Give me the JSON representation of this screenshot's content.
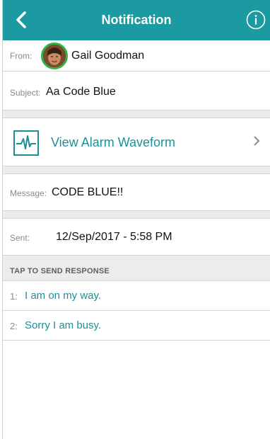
{
  "nav": {
    "title": "Notification"
  },
  "from": {
    "label": "From:",
    "name": "Gail Goodman"
  },
  "subject": {
    "label": "Subject:",
    "value": "Aa Code Blue"
  },
  "waveform": {
    "label": "View Alarm Waveform"
  },
  "message": {
    "label": "Message:",
    "value": "CODE BLUE!!"
  },
  "sent": {
    "label": "Sent:",
    "value": "12/Sep/2017 - 5:58 PM"
  },
  "responses": {
    "header": "TAP TO SEND RESPONSE",
    "items": [
      {
        "index": "1:",
        "text": "I am on my way."
      },
      {
        "index": "2:",
        "text": "Sorry I am busy."
      }
    ]
  },
  "colors": {
    "accent": "#1c9aa2",
    "avatar_ring": "#31b34a",
    "link": "#1c8f98"
  }
}
